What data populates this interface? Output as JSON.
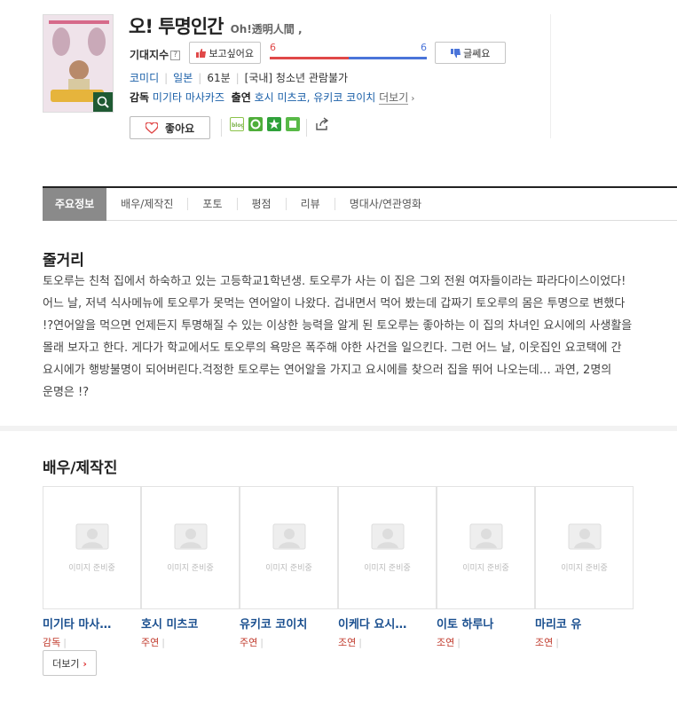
{
  "movie": {
    "title": "오! 투명인간",
    "original_title": "Oh!透明人間 ,",
    "expect_label": "기대지수",
    "help_icon": "?",
    "want_label": "보고싶어요",
    "want_count": "6",
    "doubt_count": "6",
    "want_ratio": 0.5,
    "doubt_label": "글쎄요",
    "genre": "코미디",
    "country": "일본",
    "runtime": "61분",
    "rating": "[국내] 청소년 관람불가",
    "director_label": "감독",
    "director": "미기타 마사카즈",
    "cast_label": "출연",
    "cast_names": "호시 미츠코, 유키코 코이치",
    "more_label": "더보기",
    "like_label": "좋아요"
  },
  "colors": {
    "want": "#e04848",
    "doubt": "#4a74d9",
    "link": "#1a5fa8",
    "role": "#c0392b"
  },
  "share_icons": [
    "blog-icon",
    "me2day-icon",
    "yozm-icon",
    "cyworld-icon",
    "share-icon"
  ],
  "tabs": [
    "주요정보",
    "배우/제작진",
    "포토",
    "평점",
    "리뷰",
    "명대사/연관영화"
  ],
  "synopsis": {
    "heading": "줄거리",
    "text": "토오루는 친척 집에서 하숙하고 있는 고등학교1학년생. 토오루가 사는 이 집은 그외 전원 여자들이라는 파라다이스이었다! 어느 날, 저녁 식사메뉴에 토오루가 못먹는 연어알이 나왔다. 겁내면서 먹어 봤는데 갑짜기 토오루의 몸은 투명으로 변했다 !?연어알을 먹으면 언제든지 투명해질 수 있는 이상한 능력을 알게 된 토오루는 좋아하는 이 집의 차녀인 요시에의 사생활을 몰래 보자고 한다. 게다가 학교에서도 토오루의 욕망은 폭주해 야한 사건을 일으킨다. 그런 어느 날, 이웃집인 요코택에 간 요시에가 행방불명이 되어버린다.걱정한 토오루는 연어알을 가지고 요시에를 찾으러 집을 뛰어 나오는데… 과연, 2명의 운명은 !?"
  },
  "cast_section": {
    "heading": "배우/제작진",
    "placeholder": "이미지 준비중",
    "more_label": "더보기",
    "people": [
      {
        "name": "미기타 마사카즈",
        "short": "미기타 마사…",
        "role": "감독"
      },
      {
        "name": "호시 미츠코",
        "short": "호시 미츠코",
        "role": "주연"
      },
      {
        "name": "유키코 코이치",
        "short": "유키코 코이치",
        "role": "주연"
      },
      {
        "name": "이케다 요시…",
        "short": "이케다 요시…",
        "role": "조연"
      },
      {
        "name": "이토 하루나",
        "short": "이토 하루나",
        "role": "조연"
      },
      {
        "name": "마리코 유",
        "short": "마리코 유",
        "role": "조연"
      }
    ]
  }
}
